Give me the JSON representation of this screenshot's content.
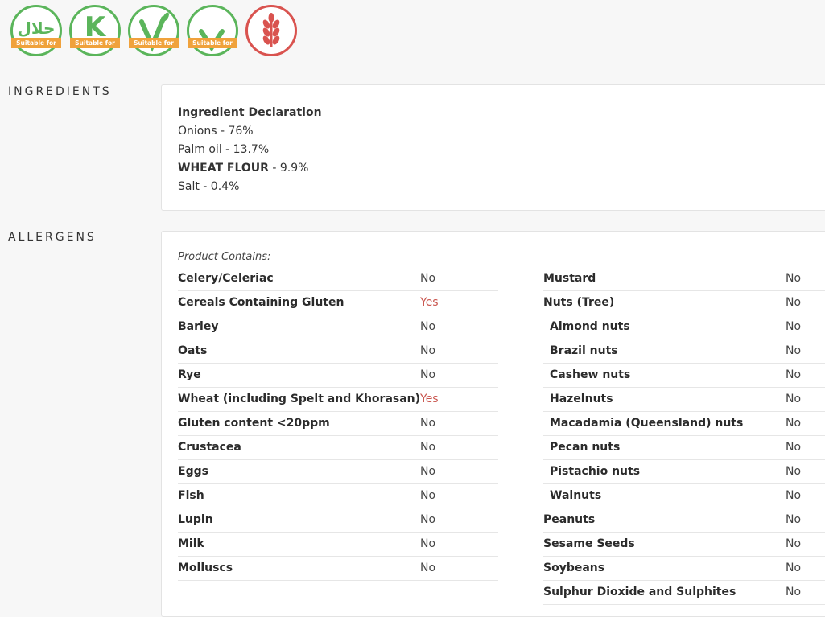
{
  "badges": [
    {
      "icon": "halal-icon",
      "glyph": "حلال",
      "ribbon": "Suitable for",
      "color": "#5bb55b"
    },
    {
      "icon": "kosher-icon",
      "glyph": "K",
      "ribbon": "Suitable for",
      "color": "#5bb55b"
    },
    {
      "icon": "vegetarian-icon",
      "glyph": "V",
      "ribbon": "Suitable for",
      "color": "#5bb55b"
    },
    {
      "icon": "vegan-icon",
      "glyph": "V",
      "ribbon": "Suitable for",
      "color": "#5bb55b"
    },
    {
      "icon": "gluten-icon",
      "glyph": "",
      "ribbon": "",
      "color": "#d9534f"
    }
  ],
  "ingredients": {
    "label": "INGREDIENTS",
    "heading": "Ingredient Declaration",
    "items": [
      {
        "name": "Onions",
        "rest": " - 76%",
        "bold": false
      },
      {
        "name": "Palm oil",
        "rest": " - 13.7%",
        "bold": false
      },
      {
        "name": "WHEAT FLOUR",
        "rest": " - 9.9%",
        "bold": true
      },
      {
        "name": "Salt",
        "rest": " - 0.4%",
        "bold": false
      }
    ]
  },
  "allergens": {
    "label": "ALLERGENS",
    "contains": "Product Contains:",
    "left": [
      {
        "name": "Celery/Celeriac",
        "value": "No",
        "sub": false
      },
      {
        "name": "Cereals Containing Gluten",
        "value": "Yes",
        "sub": false
      },
      {
        "name": "Barley",
        "value": "No",
        "sub": false
      },
      {
        "name": "Oats",
        "value": "No",
        "sub": false
      },
      {
        "name": "Rye",
        "value": "No",
        "sub": false
      },
      {
        "name": "Wheat (including Spelt and Khorasan)",
        "value": "Yes",
        "sub": false
      },
      {
        "name": "Gluten content <20ppm",
        "value": "No",
        "sub": false
      },
      {
        "name": "Crustacea",
        "value": "No",
        "sub": false
      },
      {
        "name": "Eggs",
        "value": "No",
        "sub": false
      },
      {
        "name": "Fish",
        "value": "No",
        "sub": false
      },
      {
        "name": "Lupin",
        "value": "No",
        "sub": false
      },
      {
        "name": "Milk",
        "value": "No",
        "sub": false
      },
      {
        "name": "Molluscs",
        "value": "No",
        "sub": false
      }
    ],
    "right": [
      {
        "name": "Mustard",
        "value": "No",
        "sub": false
      },
      {
        "name": "Nuts (Tree)",
        "value": "No",
        "sub": false
      },
      {
        "name": "Almond nuts",
        "value": "No",
        "sub": true
      },
      {
        "name": "Brazil nuts",
        "value": "No",
        "sub": true
      },
      {
        "name": "Cashew nuts",
        "value": "No",
        "sub": true
      },
      {
        "name": "Hazelnuts",
        "value": "No",
        "sub": true
      },
      {
        "name": "Macadamia (Queensland) nuts",
        "value": "No",
        "sub": true
      },
      {
        "name": "Pecan nuts",
        "value": "No",
        "sub": true
      },
      {
        "name": "Pistachio nuts",
        "value": "No",
        "sub": true
      },
      {
        "name": "Walnuts",
        "value": "No",
        "sub": true
      },
      {
        "name": "Peanuts",
        "value": "No",
        "sub": false
      },
      {
        "name": "Sesame Seeds",
        "value": "No",
        "sub": false
      },
      {
        "name": "Soybeans",
        "value": "No",
        "sub": false
      },
      {
        "name": "Sulphur Dioxide and Sulphites",
        "value": "No",
        "sub": false
      }
    ]
  }
}
